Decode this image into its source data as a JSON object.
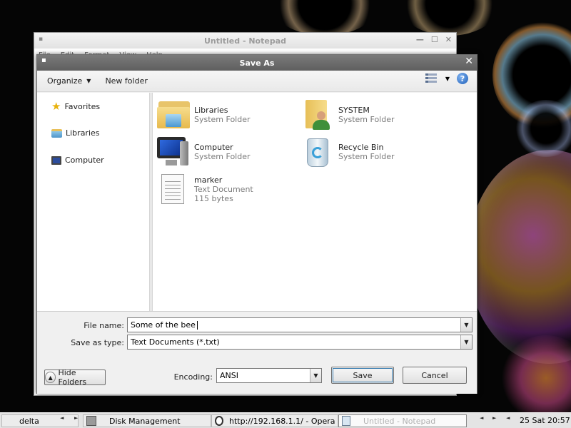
{
  "notepad": {
    "title": "Untitled - Notepad",
    "menu": [
      "File",
      "Edit",
      "Format",
      "View",
      "Help"
    ]
  },
  "dialog": {
    "title": "Save As",
    "close_glyph": "✕",
    "toolbar": {
      "organize_label": "Organize",
      "new_folder_label": "New folder",
      "help_glyph": "?"
    },
    "nav": {
      "favorites": "Favorites",
      "libraries": "Libraries",
      "computer": "Computer"
    },
    "files": [
      {
        "name": "Libraries",
        "type": "System Folder",
        "icon": "libraries-folder-icon"
      },
      {
        "name": "SYSTEM",
        "type": "System Folder",
        "icon": "user-folder-icon"
      },
      {
        "name": "Computer",
        "type": "System Folder",
        "icon": "computer-icon"
      },
      {
        "name": "Recycle Bin",
        "type": "System Folder",
        "icon": "recycle-bin-icon"
      },
      {
        "name": "marker",
        "type": "Text Document",
        "size": "115 bytes",
        "icon": "text-document-icon"
      }
    ],
    "form": {
      "file_name_label": "File name:",
      "file_name_value": "Some of the bee",
      "save_type_label": "Save as type:",
      "save_type_value": "Text Documents (*.txt)",
      "encoding_label": "Encoding:",
      "encoding_value": "ANSI",
      "hide_folders_label": "Hide Folders",
      "save_label": "Save",
      "cancel_label": "Cancel"
    }
  },
  "taskbar": {
    "workspace": "delta",
    "tasks": [
      {
        "label": "Disk Management"
      },
      {
        "label": "http://192.168.1.1/ - Opera"
      },
      {
        "label": "Untitled - Notepad"
      }
    ],
    "clock": "25 Sat 20:57"
  }
}
